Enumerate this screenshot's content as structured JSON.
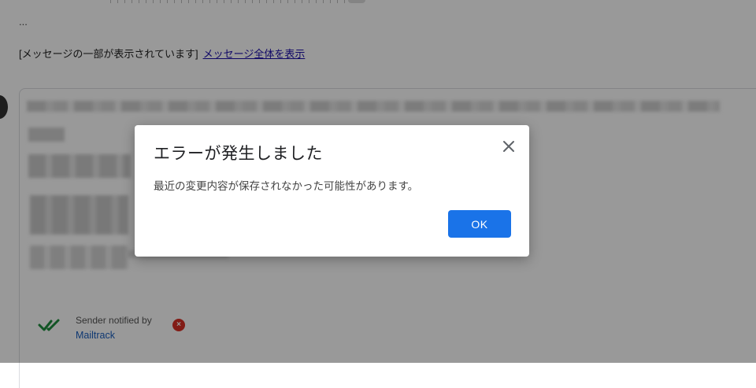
{
  "email": {
    "ellipsis": "...",
    "partial_notice": "[メッセージの一部が表示されています]",
    "show_full_link": "メッセージ全体を表示",
    "mailtrack": {
      "status_text": "Sender notified by",
      "brand": "Mailtrack",
      "check_color": "#1e8e3e",
      "remove_icon": "×"
    }
  },
  "dialog": {
    "title": "エラーが発生しました",
    "message": "最近の変更内容が保存されなかった可能性があります。",
    "ok_label": "OK",
    "close_icon": "close-icon",
    "accent": "#1a73e8"
  }
}
